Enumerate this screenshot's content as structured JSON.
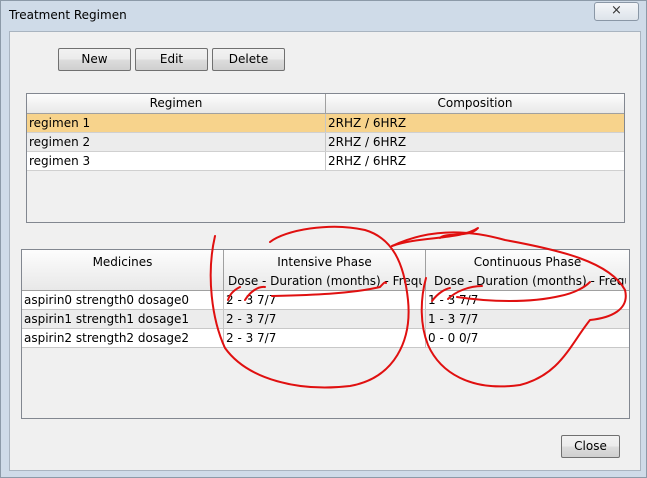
{
  "window": {
    "title": "Treatment Regimen",
    "close_glyph": "×"
  },
  "toolbar": {
    "new_label": "New",
    "edit_label": "Edit",
    "delete_label": "Delete"
  },
  "regimen_table": {
    "headers": [
      "Regimen",
      "Composition"
    ],
    "rows": [
      {
        "regimen": "regimen 1",
        "composition": "2RHZ / 6HRZ",
        "selected": true
      },
      {
        "regimen": "regimen 2",
        "composition": "2RHZ / 6HRZ",
        "selected": false
      },
      {
        "regimen": "regimen 3",
        "composition": "2RHZ / 6HRZ",
        "selected": false
      }
    ]
  },
  "medicines_table": {
    "medicines_header": "Medicines",
    "intensive_header": "Intensive Phase",
    "intensive_sub": "Dose - Duration (months) - Freque...",
    "continuous_header": "Continuous Phase",
    "continuous_sub": "Dose - Duration (months) - Frequ...",
    "rows": [
      {
        "medicine": "aspirin0 strength0 dosage0",
        "intensive": "2 - 3  7/7",
        "continuous": "1 - 3  7/7"
      },
      {
        "medicine": "aspirin1 strength1 dosage1",
        "intensive": "2 - 3  7/7",
        "continuous": "1 - 3  7/7"
      },
      {
        "medicine": "aspirin2 strength2 dosage2",
        "intensive": "2 - 3  7/7",
        "continuous": "0 - 0  0/7"
      }
    ]
  },
  "footer": {
    "close_label": "Close"
  },
  "colors": {
    "selection": "#f7d38c",
    "annotation": "#e01010",
    "frame": "#cfdbe8"
  }
}
